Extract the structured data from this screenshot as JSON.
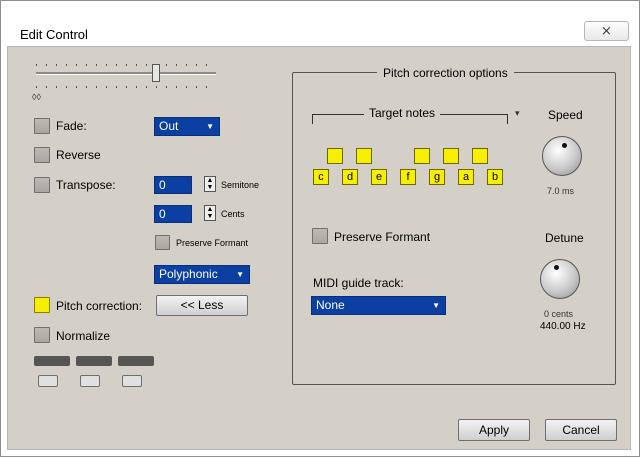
{
  "window": {
    "title": "Edit Control",
    "close_glyph": "⨯"
  },
  "left": {
    "slider_hint": "◊◊",
    "fade": {
      "label": "Fade:",
      "value": "Out"
    },
    "reverse": {
      "label": "Reverse"
    },
    "transpose": {
      "label": "Transpose:",
      "semitone_value": "0",
      "semitone_unit": "Semitone",
      "cents_value": "0",
      "cents_unit": "Cents"
    },
    "preserve_formant": {
      "label": "Preserve Formant"
    },
    "mode": {
      "value": "Polyphonic"
    },
    "pitch_correction": {
      "label": "Pitch correction:",
      "button": "<< Less"
    },
    "normalize": {
      "label": "Normalize"
    }
  },
  "pitch_panel": {
    "title": "Pitch correction options",
    "target_notes_label": "Target notes",
    "notes": [
      "c",
      "d",
      "e",
      "f",
      "g",
      "a",
      "b"
    ],
    "sharps": [
      "c#",
      "d#",
      "f#",
      "g#",
      "a#"
    ],
    "speed": {
      "label": "Speed",
      "value": "7.0 ms"
    },
    "preserve_formant": {
      "label": "Preserve Formant"
    },
    "midi": {
      "label": "MIDI guide track:",
      "value": "None"
    },
    "detune": {
      "label": "Detune",
      "value": "0 cents",
      "freq": "440.00 Hz"
    }
  },
  "footer": {
    "apply": "Apply",
    "cancel": "Cancel"
  }
}
